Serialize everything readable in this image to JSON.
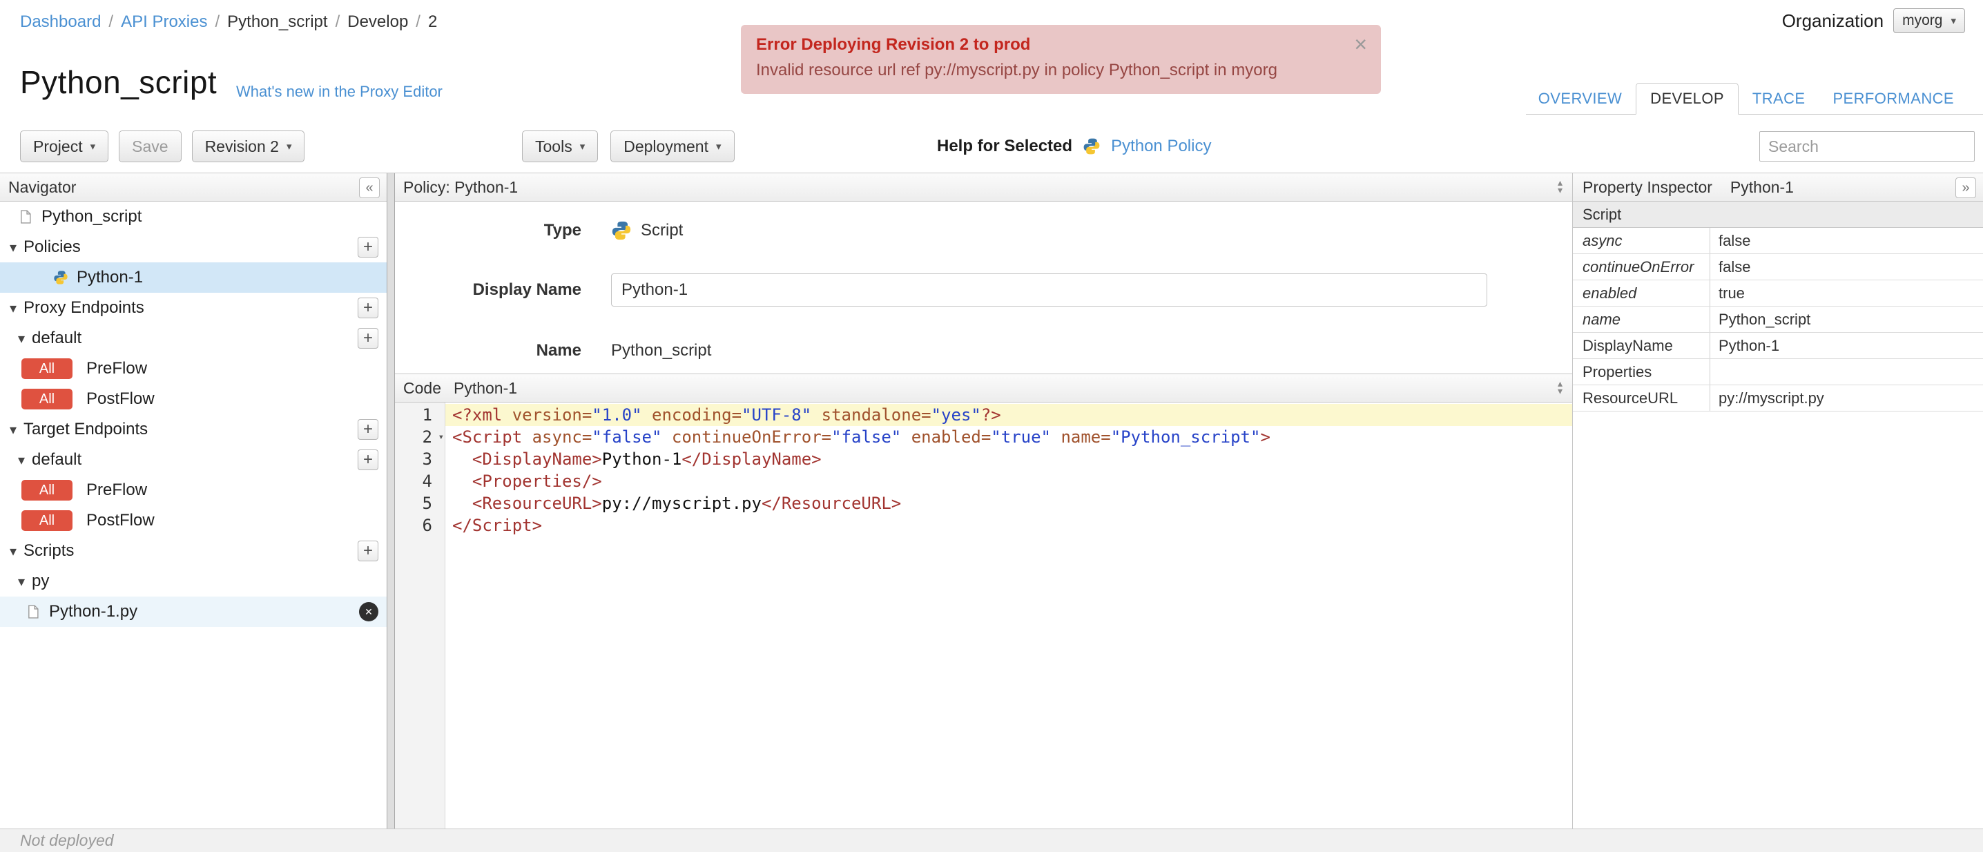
{
  "colors": {
    "link": "#4a90d2",
    "badge": "#df5240",
    "selection": "#d2e7f7",
    "error_bg": "#e9c6c6",
    "error_title": "#c3261e",
    "error_text": "#964643",
    "code_tag": "#a23430",
    "code_attr": "#a0522d",
    "code_string": "#2743c8",
    "active_line": "#fcf8cf"
  },
  "icons": {
    "caret_down": "▾",
    "tree_caret": "▾",
    "collapse_left": "«",
    "expand_right": "»",
    "close": "×",
    "delete": "✕",
    "plus": "+",
    "panel_up": "▴",
    "panel_down": "▾"
  },
  "breadcrumb": [
    {
      "label": "Dashboard",
      "link": true
    },
    {
      "label": "API Proxies",
      "link": true
    },
    {
      "label": "Python_script",
      "link": false
    },
    {
      "label": "Develop",
      "link": false
    },
    {
      "label": "2",
      "link": false
    }
  ],
  "organization": {
    "label": "Organization",
    "value": "myorg"
  },
  "error_banner": {
    "title": "Error Deploying Revision 2 to prod",
    "message": "Invalid resource url ref py://myscript.py in policy Python_script in myorg"
  },
  "header": {
    "title": "Python_script",
    "whats_new": "What's new in the Proxy Editor"
  },
  "tabs": [
    {
      "label": "OVERVIEW",
      "active": false
    },
    {
      "label": "DEVELOP",
      "active": true
    },
    {
      "label": "TRACE",
      "active": false
    },
    {
      "label": "PERFORMANCE",
      "active": false
    }
  ],
  "toolbar": {
    "project": "Project",
    "save": "Save",
    "revision": "Revision 2",
    "tools": "Tools",
    "deployment": "Deployment",
    "help_label": "Help for Selected",
    "help_link": "Python Policy",
    "search_placeholder": "Search"
  },
  "navigator": {
    "title": "Navigator",
    "items": [
      {
        "kind": "leaf",
        "level": 0,
        "icon": "page",
        "label": "Python_script"
      },
      {
        "kind": "section",
        "label": "Policies",
        "plus": true
      },
      {
        "kind": "leaf",
        "level": 1,
        "icon": "python",
        "label": "Python-1",
        "selected": true
      },
      {
        "kind": "section",
        "label": "Proxy Endpoints",
        "plus": true
      },
      {
        "kind": "subsection",
        "label": "default",
        "plus": true
      },
      {
        "kind": "flow",
        "badge": "All",
        "label": "PreFlow"
      },
      {
        "kind": "flow",
        "badge": "All",
        "label": "PostFlow"
      },
      {
        "kind": "section",
        "label": "Target Endpoints",
        "plus": true
      },
      {
        "kind": "subsection",
        "label": "default",
        "plus": true
      },
      {
        "kind": "flow",
        "badge": "All",
        "label": "PreFlow"
      },
      {
        "kind": "flow",
        "badge": "All",
        "label": "PostFlow"
      },
      {
        "kind": "section",
        "label": "Scripts",
        "plus": true
      },
      {
        "kind": "subsection",
        "label": "py"
      },
      {
        "kind": "leaf",
        "level": 2,
        "icon": "file",
        "label": "Python-1.py",
        "close": true,
        "subtle": true
      }
    ]
  },
  "policy_panel": {
    "title": "Policy: Python-1",
    "type_label": "Type",
    "type_value": "Script",
    "display_name_label": "Display Name",
    "display_name_value": "Python-1",
    "name_label": "Name",
    "name_value": "Python_script"
  },
  "code_panel": {
    "title": "Code",
    "subtitle": "Python-1",
    "lines": [
      {
        "no": "1",
        "active": true,
        "tokens": [
          {
            "t": "tag",
            "v": "<?xml "
          },
          {
            "t": "attr",
            "v": "version="
          },
          {
            "t": "str",
            "v": "\"1.0\""
          },
          {
            "t": "plain",
            "v": " "
          },
          {
            "t": "attr",
            "v": "encoding="
          },
          {
            "t": "str",
            "v": "\"UTF-8\""
          },
          {
            "t": "plain",
            "v": " "
          },
          {
            "t": "attr",
            "v": "standalone="
          },
          {
            "t": "str",
            "v": "\"yes\""
          },
          {
            "t": "tag",
            "v": "?>"
          }
        ]
      },
      {
        "no": "2",
        "fold": true,
        "tokens": [
          {
            "t": "tag",
            "v": "<Script "
          },
          {
            "t": "attr",
            "v": "async="
          },
          {
            "t": "str",
            "v": "\"false\""
          },
          {
            "t": "plain",
            "v": " "
          },
          {
            "t": "attr",
            "v": "continueOnError="
          },
          {
            "t": "str",
            "v": "\"false\""
          },
          {
            "t": "plain",
            "v": " "
          },
          {
            "t": "attr",
            "v": "enabled="
          },
          {
            "t": "str",
            "v": "\"true\""
          },
          {
            "t": "plain",
            "v": " "
          },
          {
            "t": "attr",
            "v": "name="
          },
          {
            "t": "str",
            "v": "\"Python_script\""
          },
          {
            "t": "tag",
            "v": ">"
          }
        ]
      },
      {
        "no": "3",
        "tokens": [
          {
            "t": "plain",
            "v": "  "
          },
          {
            "t": "tag",
            "v": "<DisplayName>"
          },
          {
            "t": "plain",
            "v": "Python-1"
          },
          {
            "t": "tag",
            "v": "</DisplayName>"
          }
        ]
      },
      {
        "no": "4",
        "tokens": [
          {
            "t": "plain",
            "v": "  "
          },
          {
            "t": "tag",
            "v": "<Properties/>"
          }
        ]
      },
      {
        "no": "5",
        "tokens": [
          {
            "t": "plain",
            "v": "  "
          },
          {
            "t": "tag",
            "v": "<ResourceURL>"
          },
          {
            "t": "plain",
            "v": "py://myscript.py"
          },
          {
            "t": "tag",
            "v": "</ResourceURL>"
          }
        ]
      },
      {
        "no": "6",
        "tokens": [
          {
            "t": "tag",
            "v": "</Script>"
          }
        ]
      }
    ]
  },
  "property_inspector": {
    "title": "Property Inspector",
    "subtitle": "Python-1",
    "section": "Script",
    "rows": [
      {
        "label": "async",
        "italic": true,
        "value": "false"
      },
      {
        "label": "continueOnError",
        "italic": true,
        "value": "false"
      },
      {
        "label": "enabled",
        "italic": true,
        "value": "true"
      },
      {
        "label": "name",
        "italic": true,
        "value": "Python_script"
      },
      {
        "label": "DisplayName",
        "italic": false,
        "value": "Python-1"
      },
      {
        "label": "Properties",
        "italic": false,
        "value": ""
      },
      {
        "label": "ResourceURL",
        "italic": false,
        "value": "py://myscript.py"
      }
    ]
  },
  "status_bar": {
    "text": "Not deployed"
  }
}
